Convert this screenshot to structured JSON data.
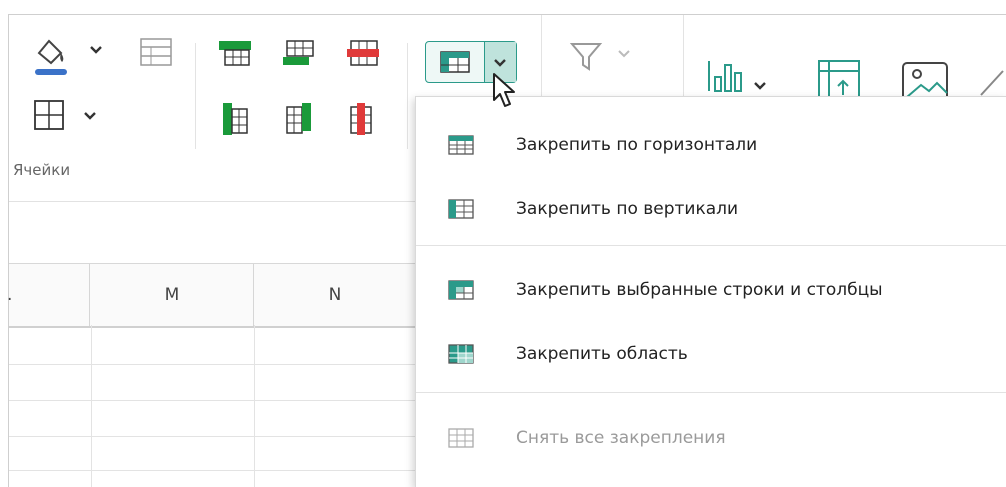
{
  "ribbon": {
    "group_label": "Ячейки"
  },
  "columns": [
    {
      "label": "."
    },
    {
      "label": "M"
    },
    {
      "label": "N"
    }
  ],
  "freeze_menu": {
    "items": [
      {
        "label": "Закрепить по горизонтали",
        "icon": "freeze-rows-icon",
        "enabled": true
      },
      {
        "label": "Закрепить по вертикали",
        "icon": "freeze-columns-icon",
        "enabled": true
      },
      {
        "label": "Закрепить выбранные строки и столбцы",
        "icon": "freeze-selected-icon",
        "enabled": true
      },
      {
        "label": "Закрепить область",
        "icon": "freeze-area-icon",
        "enabled": true
      },
      {
        "label": "Снять все закрепления",
        "icon": "unfreeze-icon",
        "enabled": false
      }
    ]
  },
  "colors": {
    "accent_green": "#1a9a3a",
    "accent_red": "#e03a3a",
    "teal": "#2b9a8a",
    "fill_blue": "#3b72c8"
  }
}
